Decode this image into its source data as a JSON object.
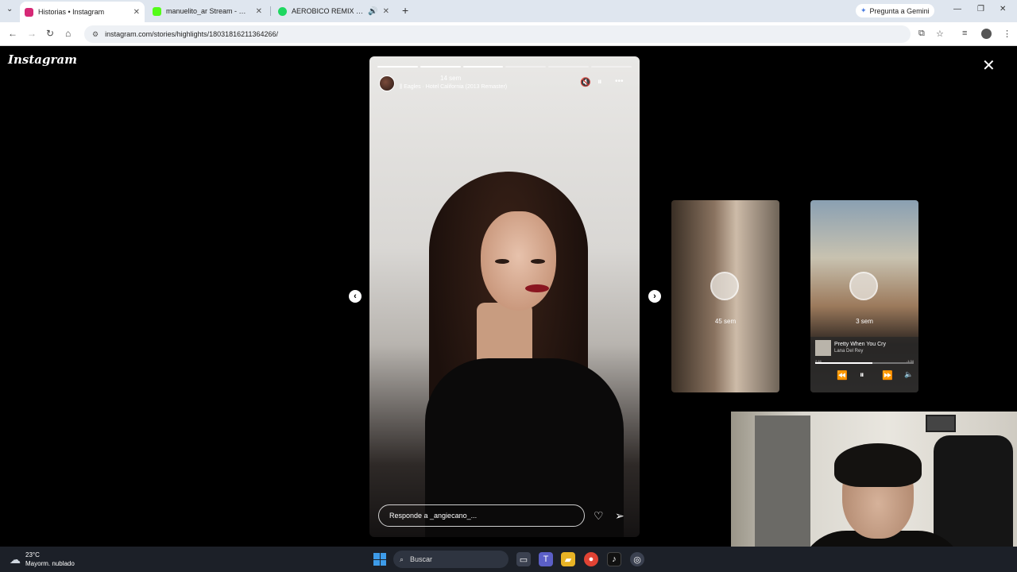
{
  "browser": {
    "tabs": [
      {
        "title": "Historias • Instagram",
        "active": true,
        "favicon_color": "#d62976"
      },
      {
        "title": "manuelito_ar Stream - Watch Li",
        "active": false,
        "favicon_color": "#53fc18"
      },
      {
        "title": "AEROBICO REMIX - Bhavi, L",
        "active": false,
        "favicon_color": "#1ed760"
      }
    ],
    "new_tab": "+",
    "gemini_label": "Pregunta a Gemini",
    "url": "instagram.com/stories/highlights/18031816211364266/"
  },
  "page": {
    "logo": "Instagram",
    "close": "✕"
  },
  "story": {
    "progress_segments": [
      1,
      1,
      1,
      0,
      0,
      0
    ],
    "time": "14 sem",
    "song": "Eagles · Hotel California (2013 Remaster)",
    "reply_placeholder": "Responde a _angiecano_..."
  },
  "previews": [
    {
      "time": "45 sem"
    },
    {
      "time": "3 sem",
      "music": {
        "title": "Pretty When You Cry",
        "artist": "Lana Del Rey",
        "elapsed": "2:44",
        "remaining": "-1:34",
        "progress": 0.58
      }
    }
  ],
  "taskbar": {
    "temperature": "23°C",
    "weather": "Mayorm. nublado",
    "search_placeholder": "Buscar"
  },
  "icons": {
    "mute": "🔇",
    "pause": "⏸",
    "more": "•••",
    "heart": "♡",
    "send": "➢",
    "prev": "‹",
    "next": "›"
  }
}
